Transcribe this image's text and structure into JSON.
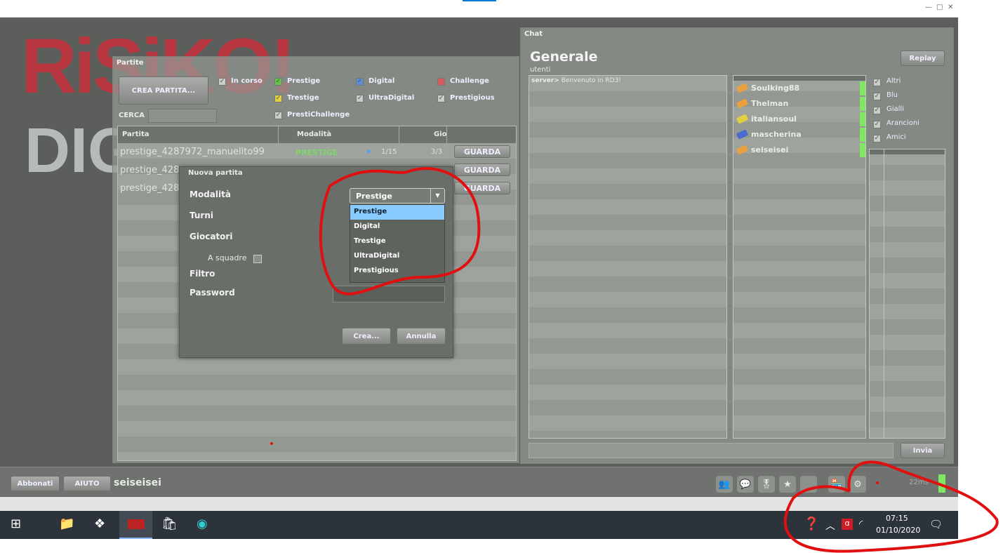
{
  "window": {
    "controls": [
      "—",
      "□",
      "✕"
    ]
  },
  "logo": {
    "top": "RiSiKO!",
    "bottom": "DIG"
  },
  "partite": {
    "title": "Partite",
    "create_button": "CREA PARTITA...",
    "search_label": "CERCA",
    "search_value": "",
    "filters": [
      {
        "label": "In corso",
        "checked": true,
        "color": "#c9ccc8"
      },
      {
        "label": "Prestige",
        "checked": true,
        "color": "#66c24a"
      },
      {
        "label": "Digital",
        "checked": true,
        "color": "#5b8fd6"
      },
      {
        "label": "Challenge",
        "checked": false,
        "color": "#d65a5a"
      },
      {
        "label": "Trestige",
        "checked": true,
        "color": "#e0d040"
      },
      {
        "label": "UltraDigital",
        "checked": true,
        "color": "#c9ccc8"
      },
      {
        "label": "Prestigious",
        "checked": true,
        "color": "#c9ccc8"
      },
      {
        "label": "PrestiChallenge",
        "checked": true,
        "color": "#c9ccc8"
      }
    ],
    "columns": [
      "Partita",
      "Modalità",
      "Gio",
      ""
    ],
    "rows": [
      {
        "name": "prestige_4287972_manuelito99",
        "mode": "PRESTIGE",
        "turn": "1/15",
        "players": "3/3",
        "action": "GUARDA"
      },
      {
        "name": "prestige_428",
        "mode": "",
        "turn": "",
        "players": "",
        "action": "GUARDA"
      },
      {
        "name": "prestige_428",
        "mode": "",
        "turn": "",
        "players": "",
        "action": "GUARDA"
      }
    ]
  },
  "dialog": {
    "title": "Nuova partita",
    "fields": {
      "mode": "Modalità",
      "turns": "Turni",
      "players": "Giocatori",
      "teams": "A squadre",
      "filter": "Filtro",
      "password": "Password"
    },
    "password_value": "",
    "mode_selected": "Prestige",
    "mode_options": [
      "Prestige",
      "Digital",
      "Trestige",
      "UltraDigital",
      "Prestigious"
    ],
    "create_button": "Crea...",
    "cancel_button": "Annulla"
  },
  "chat": {
    "title": "Chat",
    "channel": "Generale",
    "subtitle": "utenti",
    "replay_button": "Replay",
    "messages": [
      {
        "sender": "server>",
        "text": "Benvenuto in RD3!"
      }
    ],
    "users": [
      {
        "name": "Soulking88",
        "color": "#e8a040"
      },
      {
        "name": "Thelman",
        "color": "#e8a040"
      },
      {
        "name": "italiansoul",
        "color": "#e0d040"
      },
      {
        "name": "mascherina",
        "color": "#4a6ad0"
      },
      {
        "name": "seiseisei",
        "color": "#e8a040"
      }
    ],
    "user_filters": [
      "Altri",
      "Blu",
      "Gialli",
      "Arancioni",
      "Amici"
    ],
    "input_value": "",
    "send_button": "Invia"
  },
  "bottombar": {
    "subscribed_button": "Abbonati",
    "help_button": "AIUTO",
    "username": "seiseisei",
    "ping": "22ms",
    "icons": [
      "users-icon",
      "chat-icon",
      "stamp-icon",
      "star-icon",
      "blank-icon",
      "shop-icon",
      "settings-icon"
    ]
  },
  "taskbar": {
    "time": "07:15",
    "date": "01/10/2020"
  }
}
